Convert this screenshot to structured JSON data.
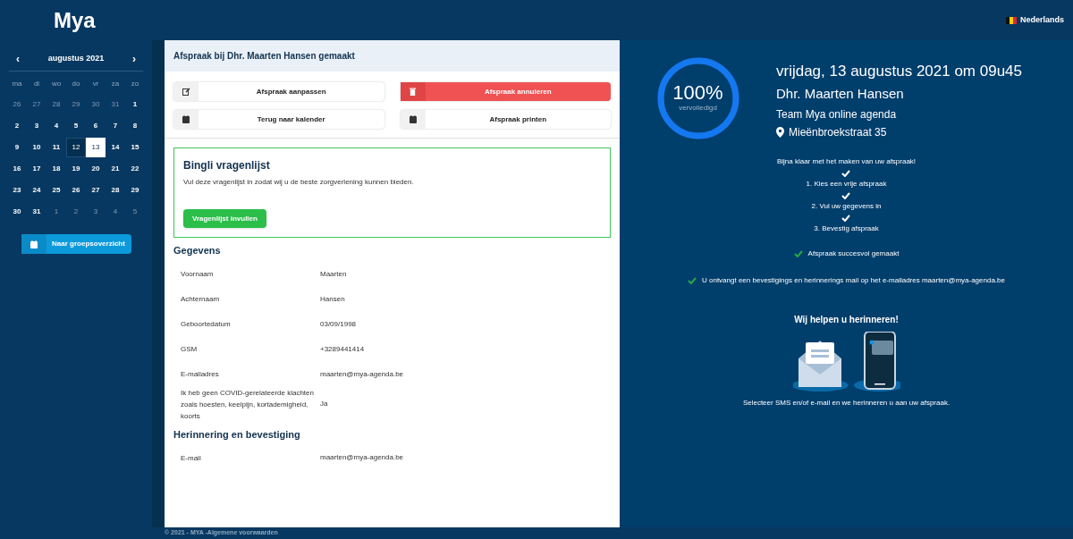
{
  "header": {
    "logo": "Mya",
    "language": "Nederlands"
  },
  "calendar": {
    "month": "augustus 2021",
    "prev": "‹",
    "next": "›",
    "weekdays": [
      "ma",
      "di",
      "wo",
      "do",
      "vr",
      "za",
      "zo"
    ],
    "days": [
      {
        "label": "26",
        "muted": true,
        "selected": false,
        "highlighted": false
      },
      {
        "label": "27",
        "muted": true,
        "selected": false,
        "highlighted": false
      },
      {
        "label": "28",
        "muted": true,
        "selected": false,
        "highlighted": false
      },
      {
        "label": "29",
        "muted": true,
        "selected": false,
        "highlighted": false
      },
      {
        "label": "30",
        "muted": true,
        "selected": false,
        "highlighted": false
      },
      {
        "label": "31",
        "muted": true,
        "selected": false,
        "highlighted": false
      },
      {
        "label": "1",
        "muted": false,
        "selected": false,
        "highlighted": false
      },
      {
        "label": "2",
        "muted": false,
        "selected": false,
        "highlighted": false
      },
      {
        "label": "3",
        "muted": false,
        "selected": false,
        "highlighted": false
      },
      {
        "label": "4",
        "muted": false,
        "selected": false,
        "highlighted": false
      },
      {
        "label": "5",
        "muted": false,
        "selected": false,
        "highlighted": false
      },
      {
        "label": "6",
        "muted": false,
        "selected": false,
        "highlighted": false
      },
      {
        "label": "7",
        "muted": false,
        "selected": false,
        "highlighted": false
      },
      {
        "label": "8",
        "muted": false,
        "selected": false,
        "highlighted": false
      },
      {
        "label": "9",
        "muted": false,
        "selected": false,
        "highlighted": false
      },
      {
        "label": "10",
        "muted": false,
        "selected": false,
        "highlighted": false
      },
      {
        "label": "11",
        "muted": false,
        "selected": false,
        "highlighted": false
      },
      {
        "label": "12",
        "muted": false,
        "selected": false,
        "highlighted": true
      },
      {
        "label": "13",
        "muted": false,
        "selected": true,
        "highlighted": false
      },
      {
        "label": "14",
        "muted": false,
        "selected": false,
        "highlighted": false
      },
      {
        "label": "15",
        "muted": false,
        "selected": false,
        "highlighted": false
      },
      {
        "label": "16",
        "muted": false,
        "selected": false,
        "highlighted": false
      },
      {
        "label": "17",
        "muted": false,
        "selected": false,
        "highlighted": false
      },
      {
        "label": "18",
        "muted": false,
        "selected": false,
        "highlighted": false
      },
      {
        "label": "19",
        "muted": false,
        "selected": false,
        "highlighted": false
      },
      {
        "label": "20",
        "muted": false,
        "selected": false,
        "highlighted": false
      },
      {
        "label": "21",
        "muted": false,
        "selected": false,
        "highlighted": false
      },
      {
        "label": "22",
        "muted": false,
        "selected": false,
        "highlighted": false
      },
      {
        "label": "23",
        "muted": false,
        "selected": false,
        "highlighted": false
      },
      {
        "label": "24",
        "muted": false,
        "selected": false,
        "highlighted": false
      },
      {
        "label": "25",
        "muted": false,
        "selected": false,
        "highlighted": false
      },
      {
        "label": "26",
        "muted": false,
        "selected": false,
        "highlighted": false
      },
      {
        "label": "27",
        "muted": false,
        "selected": false,
        "highlighted": false
      },
      {
        "label": "28",
        "muted": false,
        "selected": false,
        "highlighted": false
      },
      {
        "label": "29",
        "muted": false,
        "selected": false,
        "highlighted": false
      },
      {
        "label": "30",
        "muted": false,
        "selected": false,
        "highlighted": false
      },
      {
        "label": "31",
        "muted": false,
        "selected": false,
        "highlighted": false
      },
      {
        "label": "1",
        "muted": true,
        "selected": false,
        "highlighted": false
      },
      {
        "label": "2",
        "muted": true,
        "selected": false,
        "highlighted": false
      },
      {
        "label": "3",
        "muted": true,
        "selected": false,
        "highlighted": false
      },
      {
        "label": "4",
        "muted": true,
        "selected": false,
        "highlighted": false
      },
      {
        "label": "5",
        "muted": true,
        "selected": false,
        "highlighted": false
      }
    ],
    "group_button": "Naar groepsoverzicht"
  },
  "main": {
    "title": "Afspraak bij Dhr. Maarten Hansen gemaakt",
    "actions": [
      {
        "label": "Afspraak aanpassen",
        "kind": "edit"
      },
      {
        "label": "Afspraak annuleren",
        "kind": "delete"
      },
      {
        "label": "Terug naar kalender",
        "kind": "calendar"
      },
      {
        "label": "Afspraak printen",
        "kind": "calendar"
      }
    ],
    "questionnaire": {
      "title": "Bingli vragenlijst",
      "text": "Vul deze vragenlijst in zodat wij u de beste zorgverlening kunnen bieden.",
      "button": "Vragenlijst invullen"
    },
    "sections": [
      {
        "title": "Gegevens",
        "rows": [
          {
            "label": "Voornaam",
            "value": "Maarten"
          },
          {
            "label": "Achternaam",
            "value": "Hansen"
          },
          {
            "label": "Geboortedatum",
            "value": "03/09/1998"
          },
          {
            "label": "GSM",
            "value": "+3289441414"
          },
          {
            "label": "E-mailadres",
            "value": "maarten@mya-agenda.be"
          },
          {
            "label": "Ik heb geen COVID-gerelateerde klachten zoals hoesten, keelpijn, kortademigheid, koorts",
            "value": "Ja"
          }
        ]
      },
      {
        "title": "Herinnering en bevestiging",
        "rows": [
          {
            "label": "E-mail",
            "value": "maarten@mya-agenda.be"
          }
        ]
      }
    ]
  },
  "summary": {
    "progress": {
      "level": 1,
      "percent": "100%",
      "caption": "vervolledigd"
    },
    "datetime": "vrijdag, 13 augustus 2021 om 09u45",
    "person": "Dhr. Maarten Hansen",
    "team": "Team Mya online agenda",
    "address": "Mieënbroekstraat 35",
    "intro": "Bijna klaar met het maken van uw afspraak!",
    "steps": [
      {
        "label": "1. Kies een vrije afspraak",
        "done": true
      },
      {
        "label": "2. Vul uw gegevens in",
        "done": true
      },
      {
        "label": "3. Bevestig afspraak",
        "done": true
      }
    ],
    "confirmations": [
      "Afspraak succesvol gemaakt",
      "U ontvangt een bevestigings en herinnerings mail op het e-mailadres maarten@mya-agenda.be"
    ],
    "reminder_title": "Wij helpen u herinneren!",
    "reminder_text": "Selecteer SMS en/of e-mail en we herinneren u aan uw afspraak."
  },
  "footer": "© 2021 - MYA -Algemene voorwaarden"
}
